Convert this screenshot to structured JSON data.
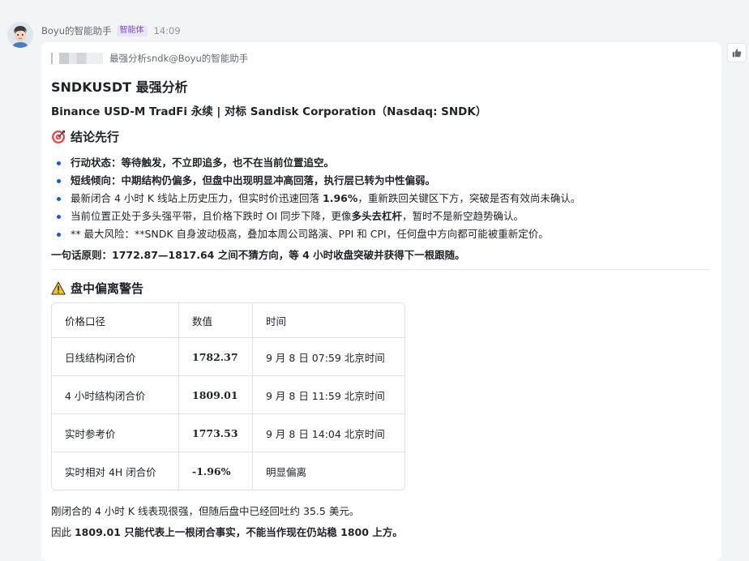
{
  "message": {
    "sender": "Boyu的智能助手",
    "badge": "智能体",
    "time": "14:09",
    "quote_text": "最强分析sndk@Boyu的智能助手"
  },
  "content": {
    "title": "SNDKUSDT 最强分析",
    "subtitle": "Binance USD-M TradFi 永续 | 对标 Sandisk Corporation（Nasdaq: SNDK）",
    "conclusion": {
      "heading": "结论先行",
      "bullets": [
        {
          "parts": [
            {
              "t": "行动状态：等待触发，不立即追多，也不在当前位置追空。",
              "b": true
            }
          ]
        },
        {
          "parts": [
            {
              "t": "短线倾向：中期结构仍偏多，但盘中出现明显冲高回落，执行层已转为中性偏弱。",
              "b": true
            }
          ]
        },
        {
          "parts": [
            {
              "t": "最新闭合 4 小时 K 线站上历史压力，但实时价迅速回落 ",
              "b": false
            },
            {
              "t": "1.96%",
              "b": true
            },
            {
              "t": "，重新跌回关键区下方，突破是否有效尚未确认。",
              "b": false
            }
          ]
        },
        {
          "parts": [
            {
              "t": "当前位置正处于多头强平带，且价格下跌时 OI 同步下降，更像",
              "b": false
            },
            {
              "t": "多头去杠杆",
              "b": true
            },
            {
              "t": "，暂时不是新空趋势确认。",
              "b": false
            }
          ]
        },
        {
          "parts": [
            {
              "t": "** 最大风险：**SNDK 自身波动极高，叠加本周公司路演、PPI 和 CPI，任何盘中方向都可能被重新定价。",
              "b": false
            }
          ]
        }
      ],
      "principle": "一句话原则：1772.87—1817.64 之间不猜方向，等 4 小时收盘突破并获得下一根跟随。"
    },
    "warning": {
      "heading": "盘中偏离警告",
      "columns": [
        "价格口径",
        "数值",
        "时间"
      ],
      "rows": [
        [
          "日线结构闭合价",
          "1782.37",
          "9 月 8 日 07:59 北京时间"
        ],
        [
          "4 小时结构闭合价",
          "1809.01",
          "9 月 8 日 11:59 北京时间"
        ],
        [
          "实时参考价",
          "1773.53",
          "9 月 8 日 14:04 北京时间"
        ],
        [
          "实时相对 4H 闭合价",
          "-1.96%",
          "明显偏离"
        ]
      ],
      "paragraphs": [
        [
          {
            "t": "刚闭合的 4 小时 K 线表现很强，但随后盘中已经回吐约 35.5 美元。",
            "b": false
          }
        ],
        [
          {
            "t": "因此 ",
            "b": false
          },
          {
            "t": "1809.01 只能代表上一根闭合事实，不能当作现在仍站稳 1800 上方。",
            "b": true
          }
        ]
      ]
    }
  },
  "icons": {
    "quote": "quote-bar-icon",
    "conclusion": "target-icon",
    "warning": "warning-icon",
    "like": "thumbs-up-icon",
    "avatar": "avatar-icon"
  },
  "colors": {
    "bullet": "#1a56db",
    "badge_bg": "#ece3fc",
    "badge_text": "#7b4fd6"
  }
}
